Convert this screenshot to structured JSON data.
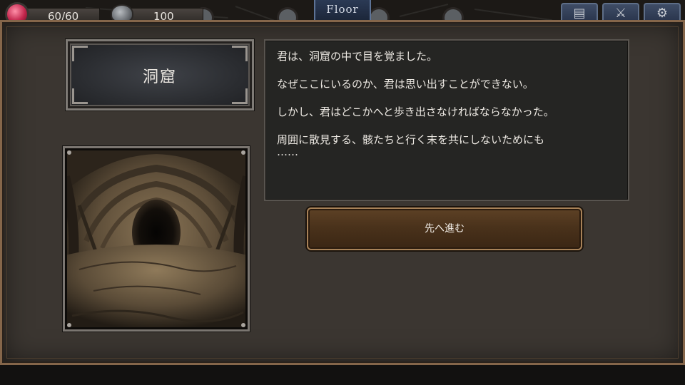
{
  "hud": {
    "hp_text": "60/60",
    "ap_text": "100",
    "floor_label": "Floor",
    "buttons": [
      {
        "icon": "book-icon"
      },
      {
        "icon": "sword-icon"
      },
      {
        "icon": "gear-icon"
      }
    ]
  },
  "event": {
    "location_title": "洞窟",
    "image_alt": "cave",
    "story": [
      "君は、洞窟の中で目を覚ました。",
      "なぜここにいるのか、君は思い出すことができない。",
      "しかし、君はどこかへと歩き出さなければならなかった。",
      "周囲に散見する、骸たちと行く末を共にしないためにも",
      "……"
    ],
    "proceed_label": "先へ進む"
  },
  "colors": {
    "panel_bg": "#3b3631",
    "panel_border": "#85664a",
    "button_bg": "#4a321b",
    "button_border": "#a88258",
    "text": "#ece8e2",
    "hp_gem": "#c2254c"
  }
}
